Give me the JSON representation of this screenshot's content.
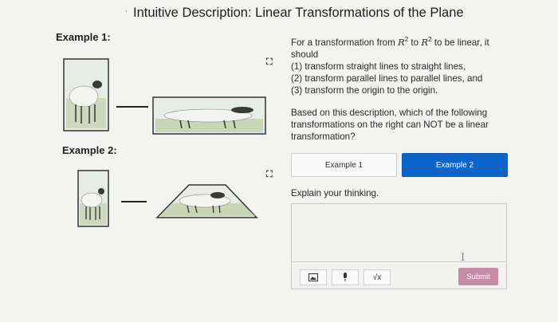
{
  "title": "Intuitive Description: Linear Transformations of the Plane",
  "title_marker": "˙",
  "examples": {
    "example1_label": "Example 1:",
    "example2_label": "Example 2:",
    "expand_icon": "⛶"
  },
  "prompt": {
    "intro_pre": "For a transformation from ",
    "R": "R",
    "sup": "2",
    "to": " to ",
    "intro_post": " to be linear, it should",
    "item1": "(1) transform straight lines to straight lines,",
    "item2": "(2) transform parallel lines to parallel lines, and",
    "item3": "(3) transform the origin to the origin."
  },
  "question": "Based on this description, which of the following transformations on the right can NOT be a linear transformation?",
  "choices": {
    "choice1": "Example 1",
    "choice2": "Example 2",
    "selected": "Example 2"
  },
  "explain_label": "Explain your thinking.",
  "answer_value": "",
  "toolbar": {
    "image_icon": "image-icon",
    "mic_icon": "microphone-icon",
    "math_icon": "√x"
  },
  "submit_label": "Submit",
  "colors": {
    "selected": "#0e63c8",
    "submit": "#c98aa5"
  }
}
